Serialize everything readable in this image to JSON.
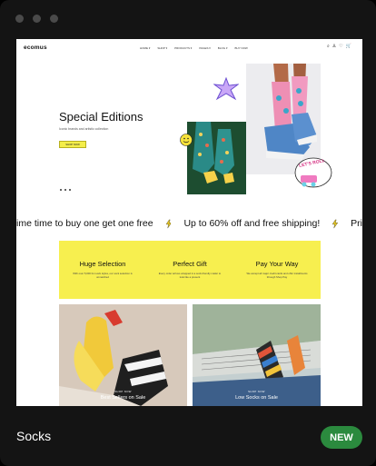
{
  "colors": {
    "accent_yellow": "#f7ef4f",
    "badge_green": "#2b8a3e"
  },
  "site": {
    "logo": "ecomus",
    "nav": [
      "HOME ▾",
      "SHOP ▾",
      "PRODUCTS ▾",
      "PAGES ▾",
      "BLOG ▾",
      "BUY NOW"
    ],
    "header_icons": [
      "search-icon",
      "user-icon",
      "heart-icon",
      "cart-icon"
    ],
    "hero": {
      "title": "Special Editions",
      "subtitle": "Iconic brands and artistic collection",
      "button": "SHOP NOW"
    },
    "ticker": [
      "ime time to buy one get one free",
      "Up to 60% off and free shipping!",
      "Pri"
    ],
    "features": [
      {
        "title": "Huge Selection",
        "text": "With over 5,000 fun sock styles, our sock selection is unmatched"
      },
      {
        "title": "Perfect Gift",
        "text": "Every order arrives wrapped in a sock-friendly mailer to look like a present"
      },
      {
        "title": "Pay Your Way",
        "text": "We accept all major credit cards and offer installments through Shop Pay"
      }
    ],
    "tiles": [
      {
        "kicker": "SHOP NOW",
        "title": "Best Sellers on Sale"
      },
      {
        "kicker": "SHOP NOW",
        "title": "Low Socks on Sale"
      }
    ],
    "sticker_text": "LET'S ROLL"
  },
  "footer": {
    "caption": "Socks",
    "badge": "NEW"
  }
}
